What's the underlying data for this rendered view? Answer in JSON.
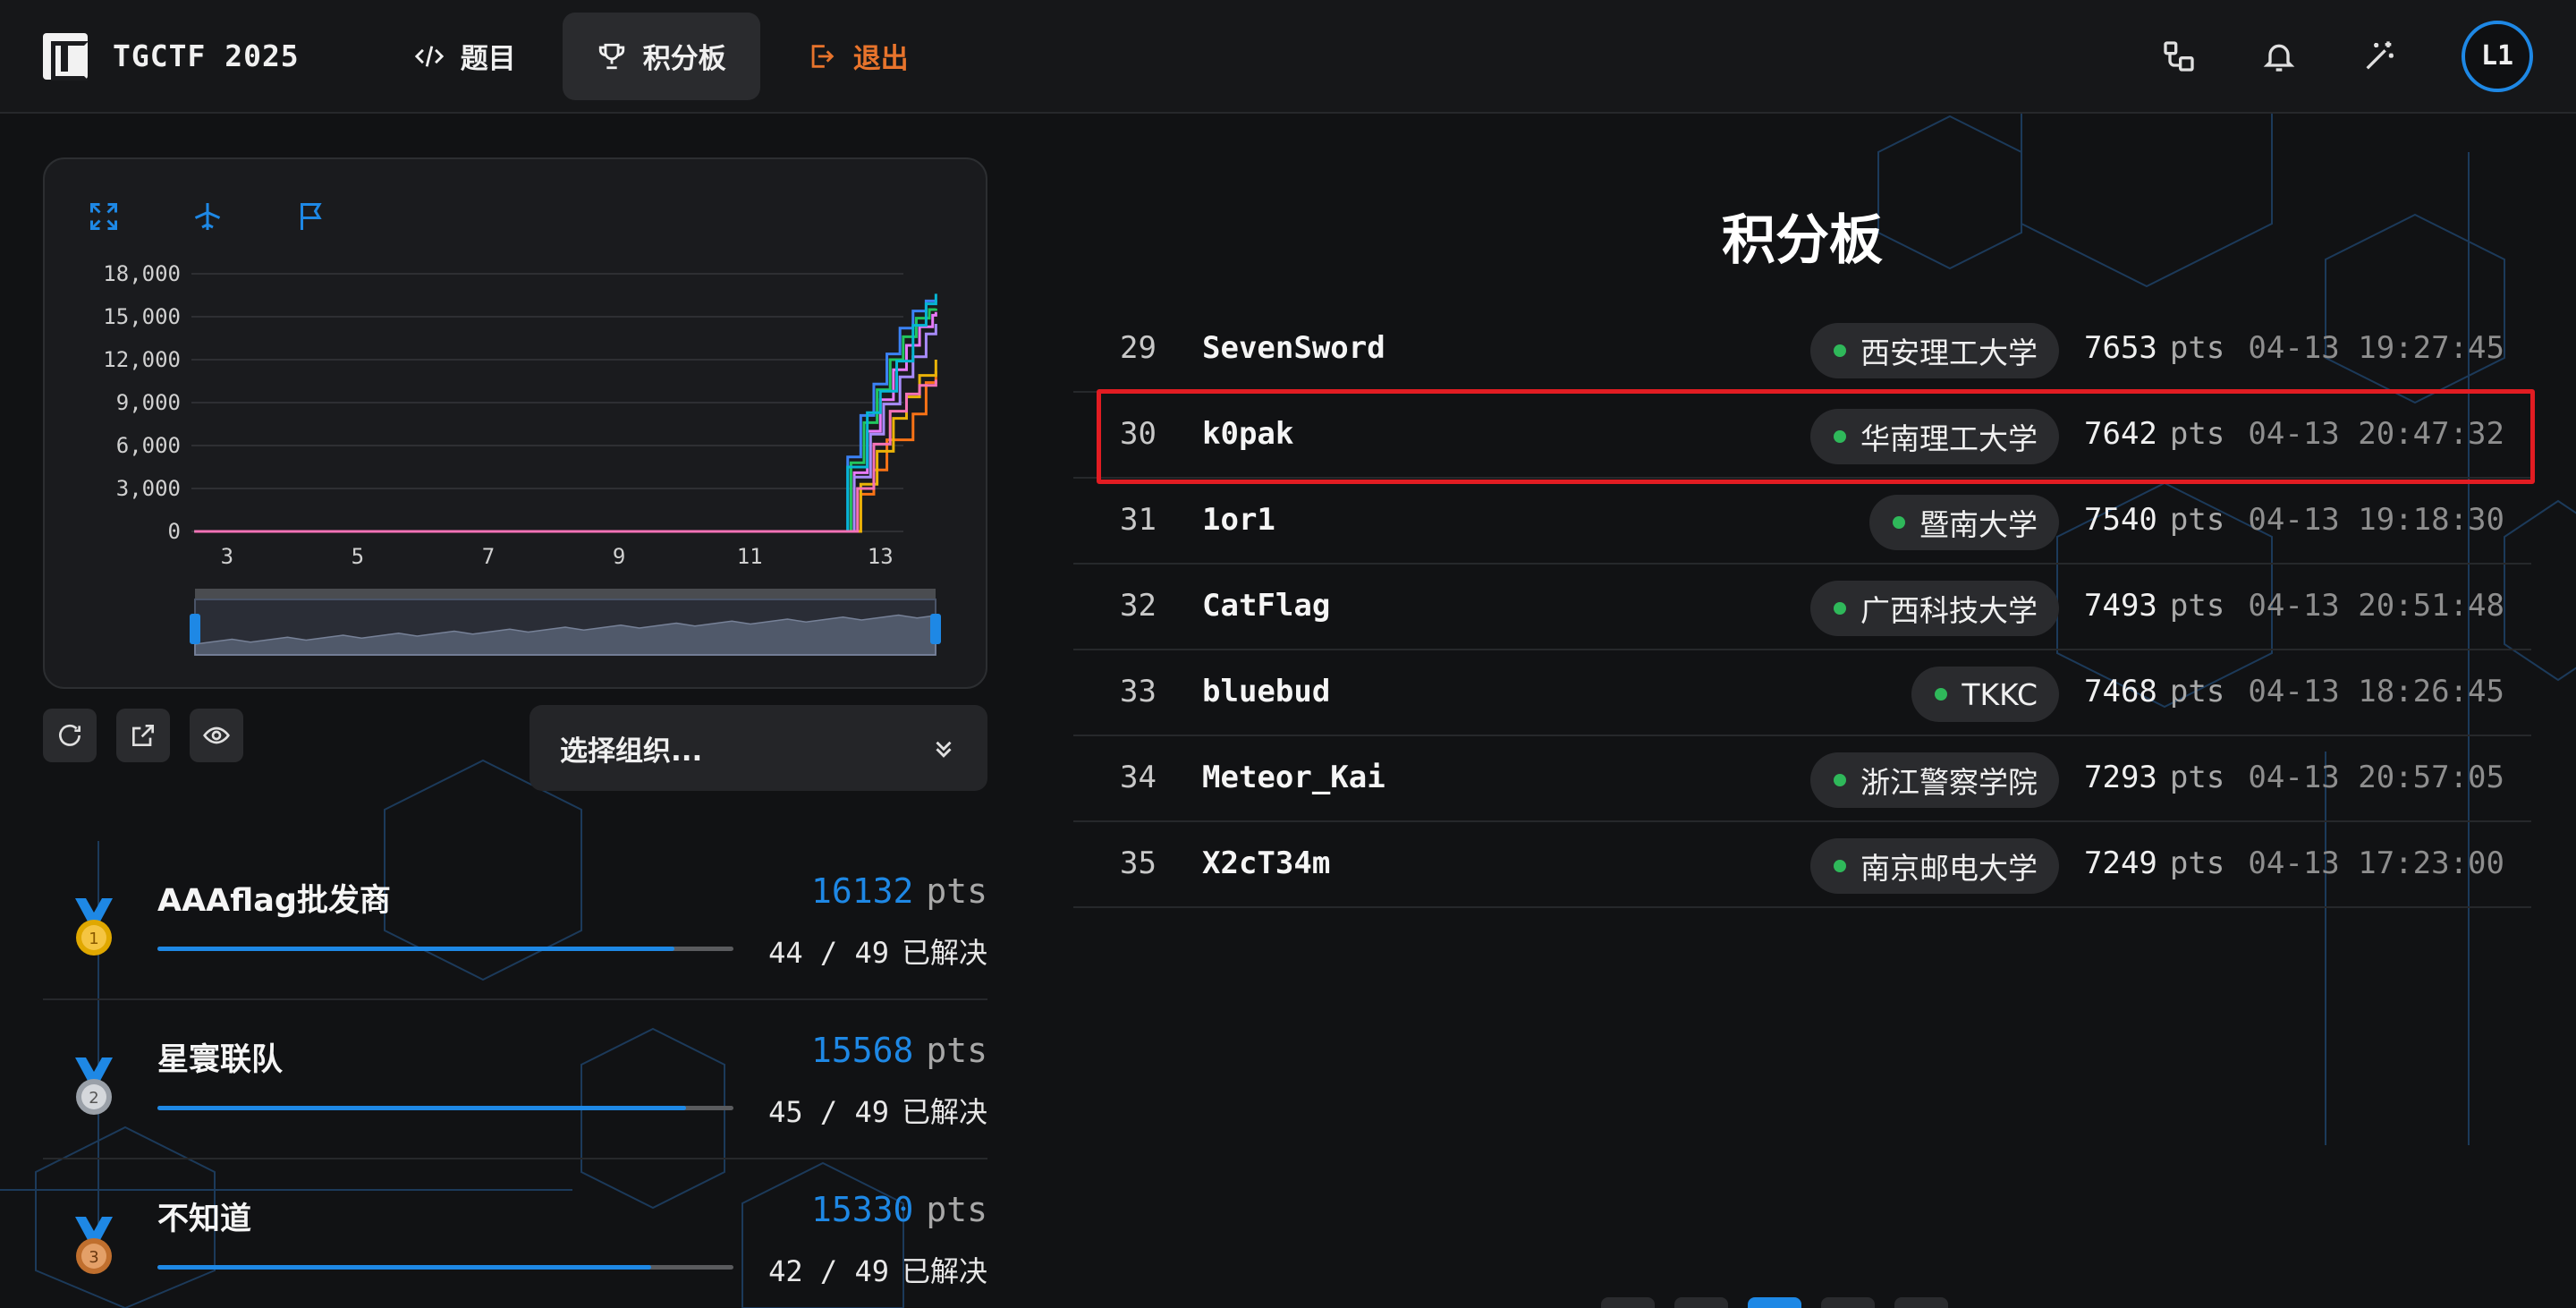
{
  "app": {
    "title": "TGCTF 2025"
  },
  "nav": {
    "challenges_label": "题目",
    "scoreboard_label": "积分板",
    "logout_label": "退出"
  },
  "user": {
    "initials": "L1"
  },
  "colors": {
    "accent": "#1e88e5",
    "logout": "#e8742c",
    "highlight_border": "#e21c22",
    "online_dot": "#2fb85a"
  },
  "chart_tools": [
    "expand-icon",
    "airplane-icon",
    "flag-icon"
  ],
  "chart_data": {
    "type": "line",
    "title": "",
    "xlabel": "",
    "ylabel": "",
    "y_ticks": [
      "0",
      "3,000",
      "6,000",
      "9,000",
      "12,000",
      "15,000",
      "18,000"
    ],
    "x_ticks": [
      "3",
      "5",
      "7",
      "9",
      "11",
      "13"
    ],
    "ylim": [
      0,
      18000
    ],
    "xlim": [
      2.4,
      13.9
    ],
    "grid": true,
    "series": [
      {
        "color": "#3b82f6",
        "x": [
          2.5,
          12.3,
          12.5,
          12.7,
          12.9,
          13.1,
          13.3,
          13.5,
          13.7,
          13.85
        ],
        "y": [
          0,
          0,
          5200,
          8100,
          10300,
          12400,
          14200,
          15400,
          16100,
          16132
        ]
      },
      {
        "color": "#22c55e",
        "x": [
          2.5,
          12.35,
          12.55,
          12.75,
          12.95,
          13.15,
          13.35,
          13.55,
          13.75,
          13.85
        ],
        "y": [
          0,
          0,
          4800,
          7600,
          9900,
          12000,
          13600,
          14900,
          15500,
          15568
        ]
      },
      {
        "color": "#e879f9",
        "x": [
          2.5,
          12.4,
          12.6,
          12.8,
          13.0,
          13.2,
          13.4,
          13.6,
          13.8,
          13.85
        ],
        "y": [
          0,
          0,
          4100,
          7000,
          9200,
          11300,
          13000,
          14300,
          15100,
          15330
        ]
      },
      {
        "color": "#f97316",
        "x": [
          2.5,
          12.45,
          12.7,
          12.9,
          13.1,
          13.3,
          13.5,
          13.7,
          13.85
        ],
        "y": [
          0,
          0,
          2600,
          4300,
          6400,
          6400,
          8200,
          10400,
          11200
        ]
      },
      {
        "color": "#a78bfa",
        "x": [
          2.5,
          12.35,
          12.6,
          12.85,
          13.05,
          13.3,
          13.5,
          13.7,
          13.85
        ],
        "y": [
          0,
          0,
          3800,
          6800,
          8900,
          10800,
          12200,
          13800,
          14500
        ]
      },
      {
        "color": "#eab308",
        "x": [
          2.5,
          12.5,
          12.7,
          12.95,
          13.2,
          13.4,
          13.6,
          13.85
        ],
        "y": [
          0,
          0,
          3300,
          5600,
          7900,
          9400,
          10900,
          12000
        ]
      },
      {
        "color": "#06b6d4",
        "x": [
          2.5,
          12.3,
          12.5,
          12.8,
          13.0,
          13.25,
          13.5,
          13.7,
          13.85
        ],
        "y": [
          0,
          0,
          4500,
          8300,
          9800,
          11900,
          14400,
          15900,
          16600
        ]
      },
      {
        "color": "#f472b6",
        "x": [
          2.5,
          12.4,
          12.65,
          12.9,
          13.15,
          13.4,
          13.6,
          13.85
        ],
        "y": [
          0,
          0,
          3000,
          6100,
          8400,
          9600,
          10200,
          10600
        ]
      }
    ]
  },
  "tools": [
    "refresh-icon",
    "external-link-icon",
    "eye-icon"
  ],
  "org_select": {
    "placeholder": "选择组织..."
  },
  "podium": [
    {
      "rank": 1,
      "name": "AAAflag批发商",
      "score": "16132",
      "unit": "pts",
      "solved": 44,
      "total": 49,
      "solved_text": "44 / 49",
      "solved_label": "已解决",
      "medal_color": "#e0a800"
    },
    {
      "rank": 2,
      "name": "星寰联队",
      "score": "15568",
      "unit": "pts",
      "solved": 45,
      "total": 49,
      "solved_text": "45 / 49",
      "solved_label": "已解决",
      "medal_color": "#b8bcc4"
    },
    {
      "rank": 3,
      "name": "不知道",
      "score": "15330",
      "unit": "pts",
      "solved": 42,
      "total": 49,
      "solved_text": "42 / 49",
      "solved_label": "已解决",
      "medal_color": "#d4894a"
    }
  ],
  "board": {
    "title": "积分板",
    "rows": [
      {
        "rank": "29",
        "team": "SevenSword",
        "school": "西安理工大学",
        "score": "7653",
        "unit": "pts",
        "time": "04-13 19:27:45",
        "highlighted": false
      },
      {
        "rank": "30",
        "team": "k0pak",
        "school": "华南理工大学",
        "score": "7642",
        "unit": "pts",
        "time": "04-13 20:47:32",
        "highlighted": true
      },
      {
        "rank": "31",
        "team": "1or1",
        "school": "暨南大学",
        "score": "7540",
        "unit": "pts",
        "time": "04-13 19:18:30",
        "highlighted": false
      },
      {
        "rank": "32",
        "team": "CatFlag",
        "school": "广西科技大学",
        "score": "7493",
        "unit": "pts",
        "time": "04-13 20:51:48",
        "highlighted": false
      },
      {
        "rank": "33",
        "team": "bluebud",
        "school": "TKKC",
        "score": "7468",
        "unit": "pts",
        "time": "04-13 18:26:45",
        "highlighted": false
      },
      {
        "rank": "34",
        "team": "Meteor_Kai",
        "school": "浙江警察学院",
        "score": "7293",
        "unit": "pts",
        "time": "04-13 20:57:05",
        "highlighted": false
      },
      {
        "rank": "35",
        "team": "X2cT34m",
        "school": "南京邮电大学",
        "score": "7249",
        "unit": "pts",
        "time": "04-13 17:23:00",
        "highlighted": false
      }
    ]
  }
}
